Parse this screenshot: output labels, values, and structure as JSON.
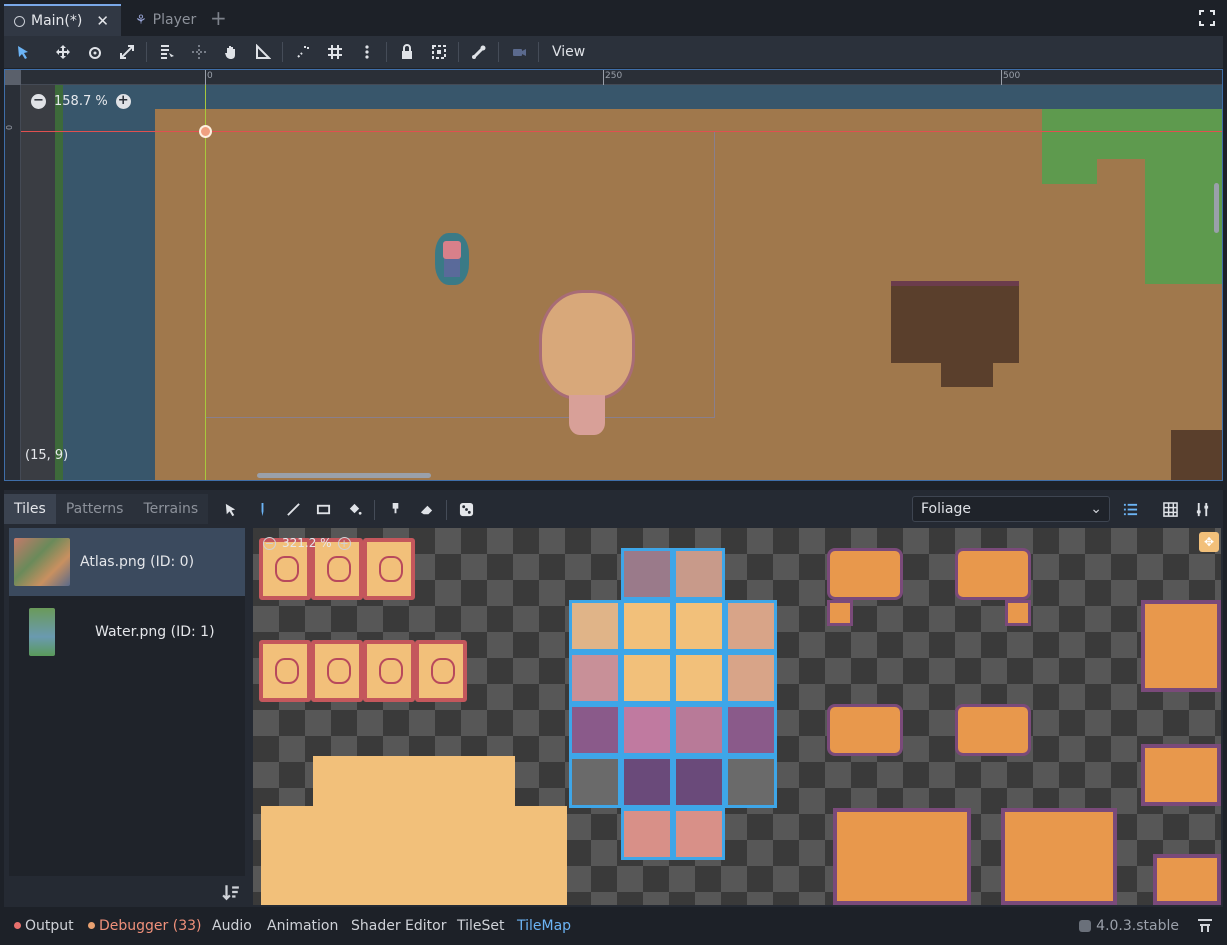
{
  "tabs": [
    {
      "label": "Main(*)",
      "icon": "node-circle-icon"
    },
    {
      "label": "Player",
      "icon": "scene-icon"
    }
  ],
  "toolbar": {
    "view_label": "View",
    "tools": [
      "select-icon",
      "move-icon",
      "rotate-icon",
      "scale-icon",
      "list-select-icon",
      "pivot-icon",
      "pan-icon",
      "ruler-icon",
      "smart-snap-icon",
      "grid-snap-icon",
      "more-icon",
      "lock-icon",
      "group-icon",
      "bone-icon",
      "camera-override-icon"
    ]
  },
  "viewport": {
    "zoom": "158.7 %",
    "ruler_marks": [
      "0",
      "250",
      "500"
    ],
    "ruler_v_mark": "0",
    "cursor_coords": "(15, 9)"
  },
  "tilemap_panel": {
    "tabs": [
      "Tiles",
      "Patterns",
      "Terrains"
    ],
    "active_tab": "Tiles",
    "tools": [
      "select-icon",
      "paint-icon",
      "line-icon",
      "rect-icon",
      "bucket-icon",
      "picker-icon",
      "eraser-icon",
      "random-icon"
    ],
    "layer_select": "Foliage",
    "sources": [
      {
        "label": "Atlas.png (ID: 0)",
        "selected": true
      },
      {
        "label": "Water.png (ID: 1)",
        "selected": false
      }
    ],
    "atlas_zoom": "321.2 %"
  },
  "statusbar": {
    "items": [
      {
        "label": "Output",
        "dot": "#e8706d"
      },
      {
        "label": "Debugger (33)",
        "dot": "#e8a070",
        "color": "#f0907a"
      },
      {
        "label": "Audio"
      },
      {
        "label": "Animation"
      },
      {
        "label": "Shader Editor"
      },
      {
        "label": "TileSet"
      },
      {
        "label": "TileMap",
        "color": "#6cb4f5"
      }
    ],
    "version": "4.0.3.stable"
  },
  "colors": {
    "accent": "#6cb4f5",
    "ground": "#a0784c",
    "water": "#38566b",
    "grass": "#5e9a4e"
  }
}
